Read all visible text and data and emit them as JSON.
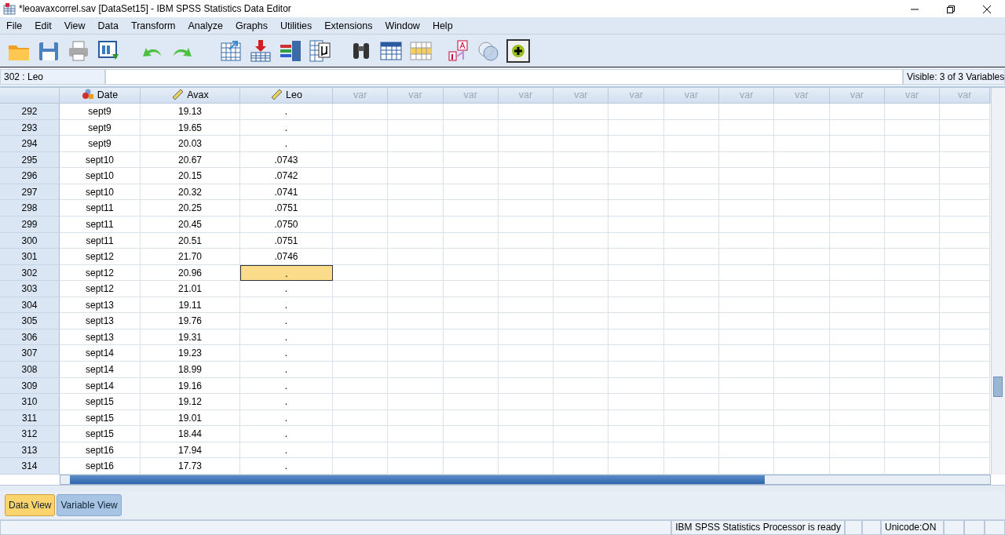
{
  "window": {
    "title": "*leoavaxcorrel.sav [DataSet15] - IBM SPSS Statistics Data Editor"
  },
  "menu": [
    "File",
    "Edit",
    "View",
    "Data",
    "Transform",
    "Analyze",
    "Graphs",
    "Utilities",
    "Extensions",
    "Window",
    "Help"
  ],
  "cell_editor": {
    "reference": "302 : Leo",
    "visible": "Visible: 3 of 3 Variables"
  },
  "columns": [
    {
      "label": "Date",
      "kind": "nominal"
    },
    {
      "label": "Avax",
      "kind": "scale"
    },
    {
      "label": "Leo",
      "kind": "scale"
    },
    {
      "label": "var",
      "kind": "empty"
    },
    {
      "label": "var",
      "kind": "empty"
    },
    {
      "label": "var",
      "kind": "empty"
    },
    {
      "label": "var",
      "kind": "empty"
    },
    {
      "label": "var",
      "kind": "empty"
    },
    {
      "label": "var",
      "kind": "empty"
    },
    {
      "label": "var",
      "kind": "empty"
    },
    {
      "label": "var",
      "kind": "empty"
    },
    {
      "label": "var",
      "kind": "empty"
    },
    {
      "label": "var",
      "kind": "empty"
    },
    {
      "label": "var",
      "kind": "empty"
    },
    {
      "label": "var",
      "kind": "empty"
    }
  ],
  "rows": [
    {
      "number": "292",
      "cells": [
        {
          "text": "sept9",
          "selected": false
        },
        {
          "text": "19.13",
          "selected": false
        },
        {
          "text": ".",
          "selected": false
        }
      ]
    },
    {
      "number": "293",
      "cells": [
        {
          "text": "sept9",
          "selected": false
        },
        {
          "text": "19.65",
          "selected": false
        },
        {
          "text": ".",
          "selected": false
        }
      ]
    },
    {
      "number": "294",
      "cells": [
        {
          "text": "sept9",
          "selected": false
        },
        {
          "text": "20.03",
          "selected": false
        },
        {
          "text": ".",
          "selected": false
        }
      ]
    },
    {
      "number": "295",
      "cells": [
        {
          "text": "sept10",
          "selected": false
        },
        {
          "text": "20.67",
          "selected": false
        },
        {
          "text": ".0743",
          "selected": false
        }
      ]
    },
    {
      "number": "296",
      "cells": [
        {
          "text": "sept10",
          "selected": false
        },
        {
          "text": "20.15",
          "selected": false
        },
        {
          "text": ".0742",
          "selected": false
        }
      ]
    },
    {
      "number": "297",
      "cells": [
        {
          "text": "sept10",
          "selected": false
        },
        {
          "text": "20.32",
          "selected": false
        },
        {
          "text": ".0741",
          "selected": false
        }
      ]
    },
    {
      "number": "298",
      "cells": [
        {
          "text": "sept11",
          "selected": false
        },
        {
          "text": "20.25",
          "selected": false
        },
        {
          "text": ".0751",
          "selected": false
        }
      ]
    },
    {
      "number": "299",
      "cells": [
        {
          "text": "sept11",
          "selected": false
        },
        {
          "text": "20.45",
          "selected": false
        },
        {
          "text": ".0750",
          "selected": false
        }
      ]
    },
    {
      "number": "300",
      "cells": [
        {
          "text": "sept11",
          "selected": false
        },
        {
          "text": "20.51",
          "selected": false
        },
        {
          "text": ".0751",
          "selected": false
        }
      ]
    },
    {
      "number": "301",
      "cells": [
        {
          "text": "sept12",
          "selected": false
        },
        {
          "text": "21.70",
          "selected": false
        },
        {
          "text": ".0746",
          "selected": false
        }
      ]
    },
    {
      "number": "302",
      "cells": [
        {
          "text": "sept12",
          "selected": false
        },
        {
          "text": "20.96",
          "selected": false
        },
        {
          "text": ".",
          "selected": true
        }
      ]
    },
    {
      "number": "303",
      "cells": [
        {
          "text": "sept12",
          "selected": false
        },
        {
          "text": "21.01",
          "selected": false
        },
        {
          "text": ".",
          "selected": false
        }
      ]
    },
    {
      "number": "304",
      "cells": [
        {
          "text": "sept13",
          "selected": false
        },
        {
          "text": "19.11",
          "selected": false
        },
        {
          "text": ".",
          "selected": false
        }
      ]
    },
    {
      "number": "305",
      "cells": [
        {
          "text": "sept13",
          "selected": false
        },
        {
          "text": "19.76",
          "selected": false
        },
        {
          "text": ".",
          "selected": false
        }
      ]
    },
    {
      "number": "306",
      "cells": [
        {
          "text": "sept13",
          "selected": false
        },
        {
          "text": "19.31",
          "selected": false
        },
        {
          "text": ".",
          "selected": false
        }
      ]
    },
    {
      "number": "307",
      "cells": [
        {
          "text": "sept14",
          "selected": false
        },
        {
          "text": "19.23",
          "selected": false
        },
        {
          "text": ".",
          "selected": false
        }
      ]
    },
    {
      "number": "308",
      "cells": [
        {
          "text": "sept14",
          "selected": false
        },
        {
          "text": "18.99",
          "selected": false
        },
        {
          "text": ".",
          "selected": false
        }
      ]
    },
    {
      "number": "309",
      "cells": [
        {
          "text": "sept14",
          "selected": false
        },
        {
          "text": "19.16",
          "selected": false
        },
        {
          "text": ".",
          "selected": false
        }
      ]
    },
    {
      "number": "310",
      "cells": [
        {
          "text": "sept15",
          "selected": false
        },
        {
          "text": "19.12",
          "selected": false
        },
        {
          "text": ".",
          "selected": false
        }
      ]
    },
    {
      "number": "311",
      "cells": [
        {
          "text": "sept15",
          "selected": false
        },
        {
          "text": "19.01",
          "selected": false
        },
        {
          "text": ".",
          "selected": false
        }
      ]
    },
    {
      "number": "312",
      "cells": [
        {
          "text": "sept15",
          "selected": false
        },
        {
          "text": "18.44",
          "selected": false
        },
        {
          "text": ".",
          "selected": false
        }
      ]
    },
    {
      "number": "313",
      "cells": [
        {
          "text": "sept16",
          "selected": false
        },
        {
          "text": "17.94",
          "selected": false
        },
        {
          "text": ".",
          "selected": false
        }
      ]
    },
    {
      "number": "314",
      "cells": [
        {
          "text": "sept16",
          "selected": false
        },
        {
          "text": "17.73",
          "selected": false
        },
        {
          "text": ".",
          "selected": false
        }
      ]
    }
  ],
  "view_tabs": [
    {
      "label": "Data View",
      "selected": true
    },
    {
      "label": "Variable View",
      "selected": false
    }
  ],
  "status_bar": {
    "message": "IBM SPSS Statistics Processor is ready",
    "encoding": "Unicode:ON"
  }
}
